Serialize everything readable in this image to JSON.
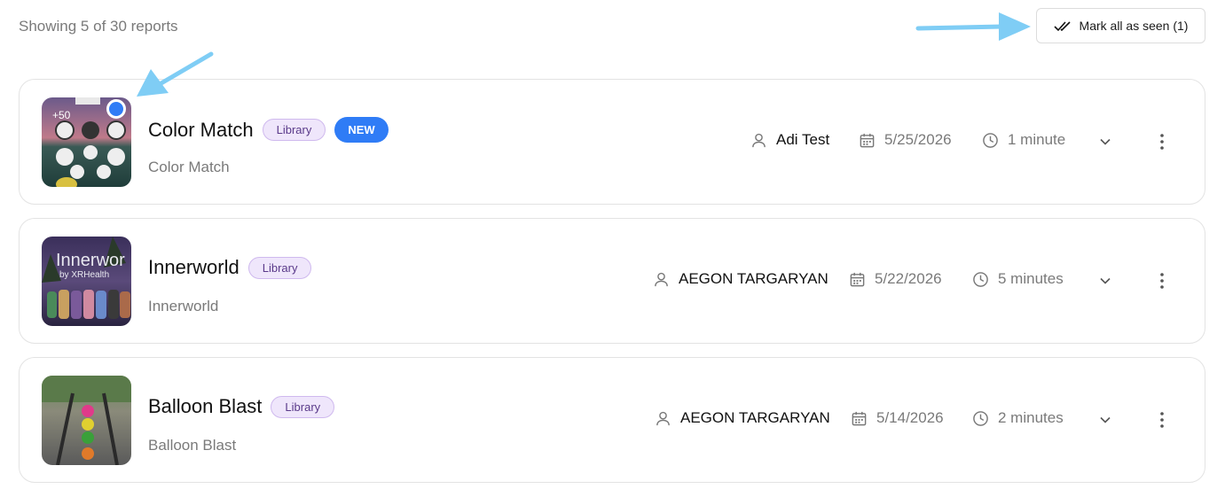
{
  "summary_text": "Showing 5 of 30 reports",
  "mark_all_button": {
    "label": "Mark all as seen (1)",
    "icon": "double-check-icon"
  },
  "colors": {
    "accent": "#2f7cf6",
    "badge_bg": "#efe6fb",
    "badge_text": "#5a3a8a",
    "annotation_arrow": "#7fcdf5"
  },
  "reports": [
    {
      "title": "Color Match",
      "badge": "Library",
      "new_badge": "NEW",
      "unread": true,
      "subtitle": "Color Match",
      "user": "Adi Test",
      "date": "5/25/2026",
      "duration": "1 minute",
      "thumb_text": "+50"
    },
    {
      "title": "Innerworld",
      "badge": "Library",
      "unread": false,
      "subtitle": "Innerworld",
      "user": "AEGON TARGARYAN",
      "date": "5/22/2026",
      "duration": "5 minutes",
      "thumb_text": "Innerwor",
      "thumb_subtext": "by XRHealth"
    },
    {
      "title": "Balloon Blast",
      "badge": "Library",
      "unread": false,
      "subtitle": "Balloon Blast",
      "user": "AEGON TARGARYAN",
      "date": "5/14/2026",
      "duration": "2 minutes"
    }
  ]
}
